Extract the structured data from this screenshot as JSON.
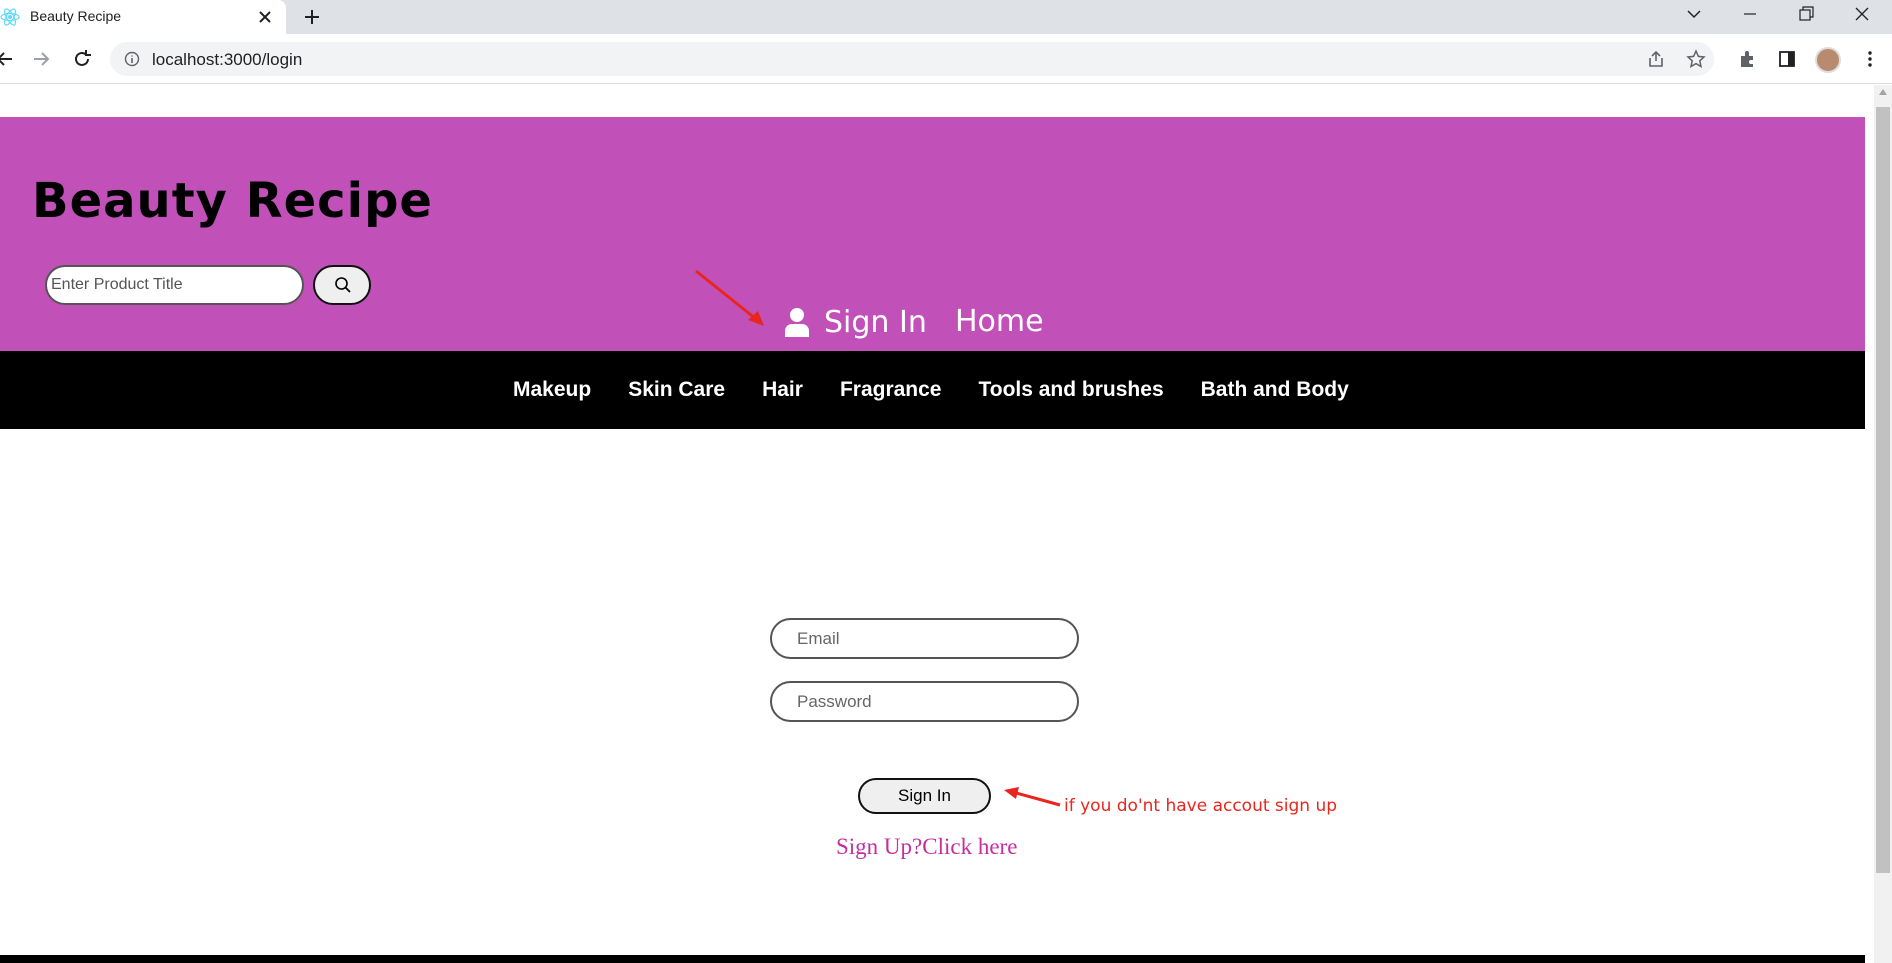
{
  "browser": {
    "tab_title": "Beauty Recipe",
    "url": "localhost:3000/login"
  },
  "header": {
    "brand": "Beauty Recipe",
    "search_placeholder": "Enter Product Title",
    "signin_label": "Sign In",
    "home_label": "Home"
  },
  "nav": {
    "items": [
      "Makeup",
      "Skin Care",
      "Hair",
      "Fragrance",
      "Tools and brushes",
      "Bath and Body"
    ]
  },
  "login": {
    "email_placeholder": "Email",
    "password_placeholder": "Password",
    "signin_button": "Sign In",
    "annotation": "if you do'nt have accout sign up",
    "signup_link": "Sign Up?Click here"
  },
  "colors": {
    "header_bg": "#c150b8",
    "nav_bg": "#000000",
    "annotation": "#e8261e",
    "signup_link": "#c42f9e"
  }
}
